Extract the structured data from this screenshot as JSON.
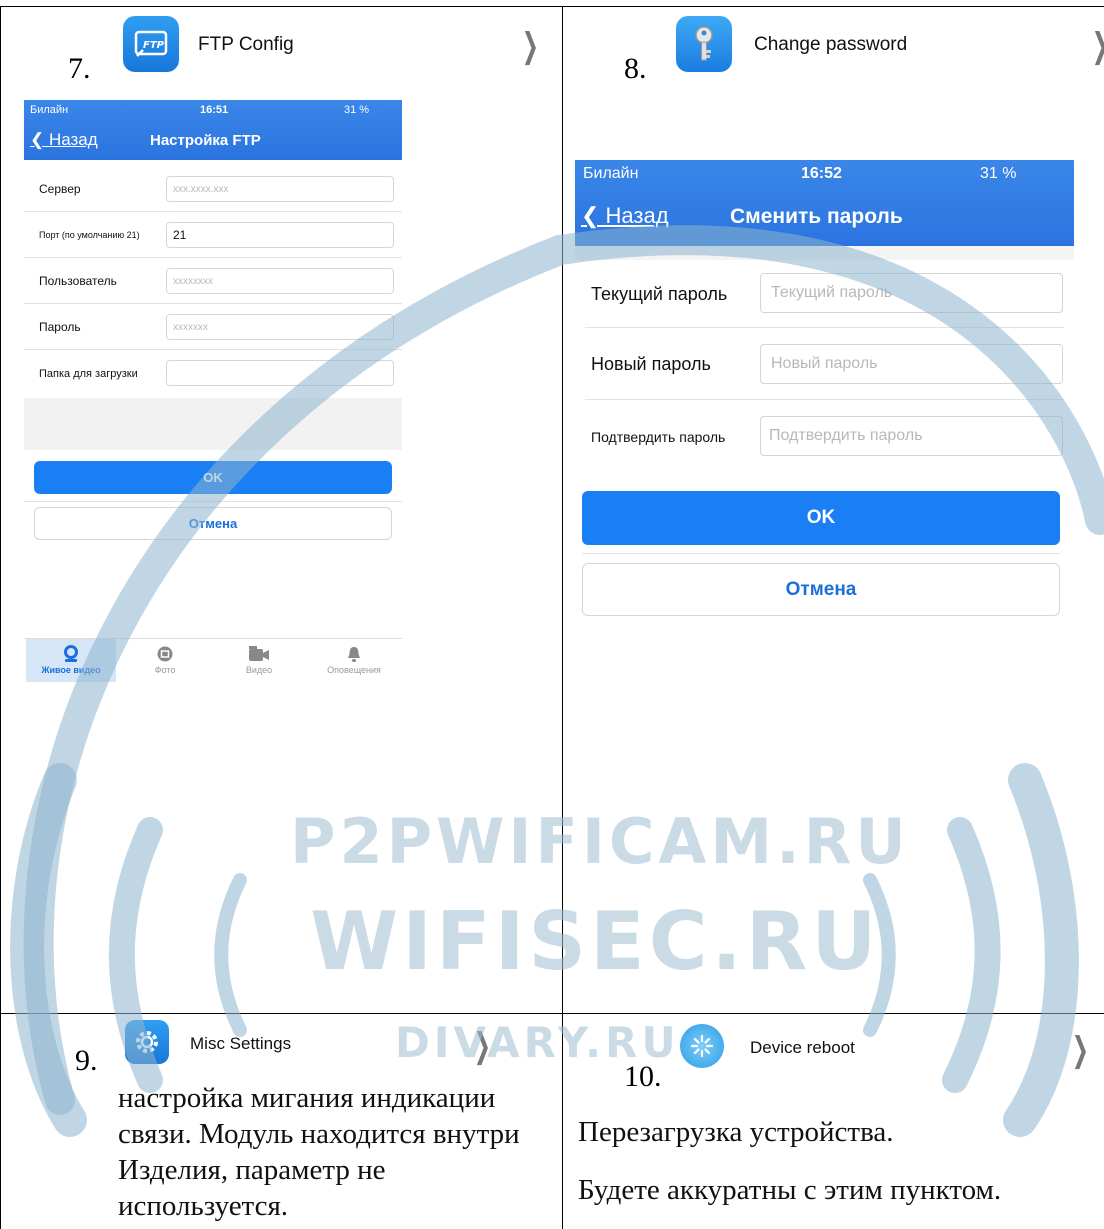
{
  "cells": {
    "c7": {
      "number": "7.",
      "title": "FTP Config"
    },
    "c8": {
      "number": "8.",
      "title": "Change password"
    },
    "c9": {
      "number": "9.",
      "title": "Misc Settings",
      "description": "настройка мигания индикации связи. Модуль находится внутри Изделия, параметр не используется."
    },
    "c10": {
      "number": "10.",
      "title": "Device reboot",
      "line1": "Перезагрузка устройства.",
      "line2": "Будете аккуратны с этим пунктом."
    }
  },
  "ftp_screen": {
    "status": {
      "carrier": "Билайн",
      "time": "16:51",
      "battery": "31 %"
    },
    "back": "Назад",
    "title": "Настройка FTP",
    "rows": [
      {
        "label": "Сервер",
        "value": "",
        "placeholder": "xxx.xxxx.xxx"
      },
      {
        "label": "Порт (по умолчанию 21)",
        "value": "21",
        "placeholder": ""
      },
      {
        "label": "Пользователь",
        "value": "",
        "placeholder": "xxxxxxxx"
      },
      {
        "label": "Пароль",
        "value": "",
        "placeholder": "xxxxxxx"
      },
      {
        "label": "Папка для загрузки",
        "value": "",
        "placeholder": ""
      }
    ],
    "ok": "OK",
    "cancel": "Отмена",
    "tabs": [
      "Живое видео",
      "Фото",
      "Видео",
      "Оповещения"
    ]
  },
  "pwd_screen": {
    "status": {
      "carrier": "Билайн",
      "time": "16:52",
      "battery": "31 %"
    },
    "back": "Назад",
    "title": "Сменить пароль",
    "rows": [
      {
        "label": "Текущий пароль",
        "placeholder": "Текущий пароль"
      },
      {
        "label": "Новый пароль",
        "placeholder": "Новый пароль"
      },
      {
        "label": "Подтвердить пароль",
        "placeholder": "Подтвердить пароль"
      }
    ],
    "ok": "OK",
    "cancel": "Отмена"
  },
  "watermark": {
    "line1": "P2PWIFICAM.RU",
    "line2": "WIFISEC.RU",
    "line3": "DIVARY.RU"
  },
  "colors": {
    "nav_blue": "#2b74e0",
    "button_blue": "#1a7ff4",
    "active_tab": "#1a6fdc",
    "watermark": "#a0bed2"
  }
}
